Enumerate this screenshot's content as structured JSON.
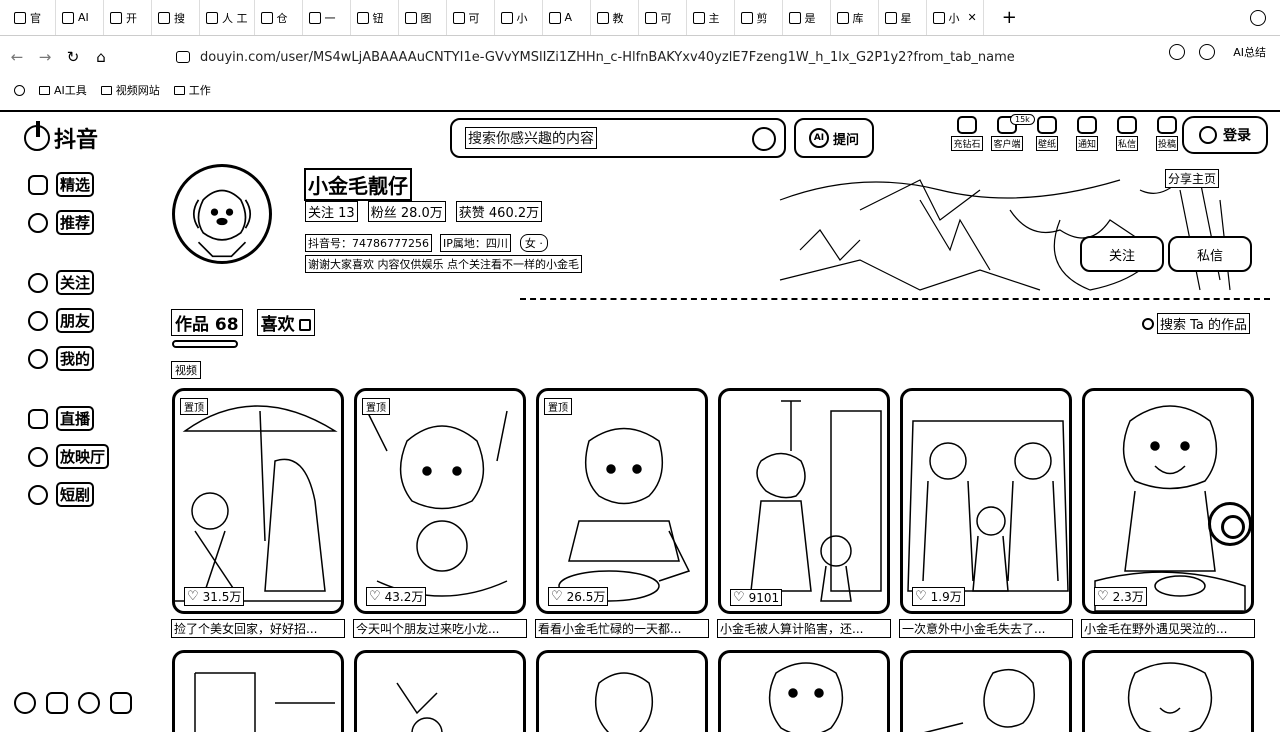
{
  "browser": {
    "tabs": [
      {
        "label": "官"
      },
      {
        "label": "AI"
      },
      {
        "label": "开"
      },
      {
        "label": "搜"
      },
      {
        "label": "人 工"
      },
      {
        "label": "仓"
      },
      {
        "label": "一"
      },
      {
        "label": "钮"
      },
      {
        "label": "图"
      },
      {
        "label": "可"
      },
      {
        "label": "小"
      },
      {
        "label": "A"
      },
      {
        "label": "教"
      },
      {
        "label": "可"
      },
      {
        "label": "主"
      },
      {
        "label": "剪"
      },
      {
        "label": "是"
      },
      {
        "label": "库"
      },
      {
        "label": "星"
      },
      {
        "label": "小"
      }
    ],
    "url": "douyin.com/user/MS4wLjABAAAAuCNTYI1e-GVvYMSlIZi1ZHHn_c-HlfnBAKYxv40yzlE7Fzeng1W_h_1lx_G2P1y2?from_tab_name=...",
    "ai_summary": "AI总结",
    "bookmarks": [
      "AI工具",
      "视频网站",
      "工作"
    ]
  },
  "site": {
    "logo": "抖音",
    "search_placeholder": "搜索你感兴趣的内容",
    "ask_label": "提问",
    "top_icons": [
      {
        "label": "充钻石"
      },
      {
        "label": "客户端"
      },
      {
        "label": "壁纸"
      },
      {
        "label": "通知"
      },
      {
        "label": "私信"
      },
      {
        "label": "投稿"
      }
    ],
    "badge": "15k",
    "login": "登录"
  },
  "sidebar": {
    "items": [
      {
        "label": "精选"
      },
      {
        "label": "推荐"
      },
      {
        "label": "关注"
      },
      {
        "label": "朋友"
      },
      {
        "label": "我的"
      },
      {
        "label": "直播"
      },
      {
        "label": "放映厅"
      },
      {
        "label": "短剧"
      }
    ]
  },
  "profile": {
    "name": "小金毛靓仔",
    "follow": "关注 13",
    "fans": "粉丝 28.0万",
    "likes": "获赞 460.2万",
    "douyin_id": "抖音号：74786777256",
    "ip": "IP属地：四川",
    "gender_tag": "女 ·",
    "bio": "谢谢大家喜欢 内容仅供娱乐 点个关注看不一样的小金毛",
    "share": "分享主页",
    "follow_btn": "关注",
    "msg_btn": "私信"
  },
  "works": {
    "tab_works": "作品 68",
    "tab_likes": "喜欢",
    "search_label": "搜索 Ta 的作品",
    "video_tag": "视频",
    "pinned_label": "置顶",
    "items": [
      {
        "pinned": true,
        "likes": "31.5万",
        "caption": "捡了个美女回家，好好招..."
      },
      {
        "pinned": true,
        "likes": "43.2万",
        "caption": "今天叫个朋友过来吃小龙..."
      },
      {
        "pinned": true,
        "likes": "26.5万",
        "caption": "看看小金毛忙碌的一天都..."
      },
      {
        "pinned": false,
        "likes": "9101",
        "caption": "小金毛被人算计陷害，还..."
      },
      {
        "pinned": false,
        "likes": "1.9万",
        "caption": "一次意外中小金毛失去了..."
      },
      {
        "pinned": false,
        "likes": "2.3万",
        "caption": "小金毛在野外遇见哭泣的..."
      }
    ]
  }
}
